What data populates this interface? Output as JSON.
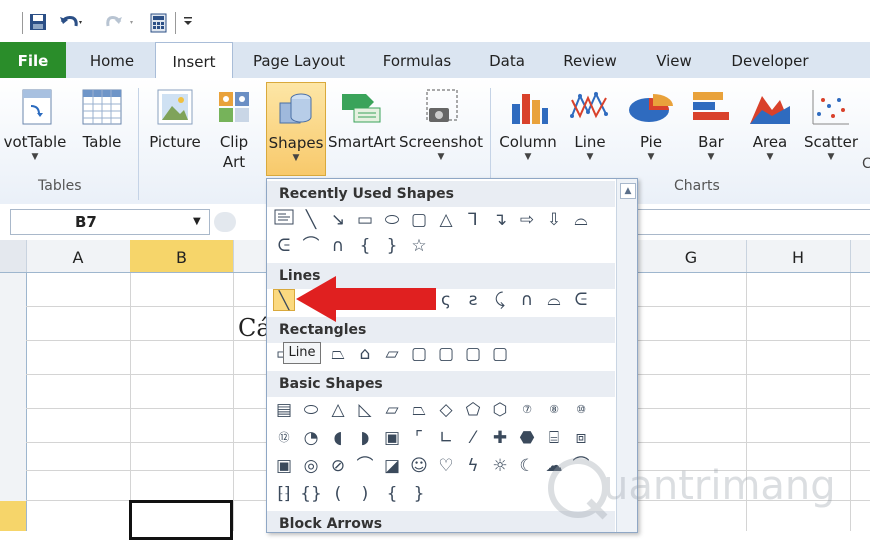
{
  "tabs": {
    "file": "File",
    "home": "Home",
    "insert": "Insert",
    "page_layout": "Page Layout",
    "formulas": "Formulas",
    "data": "Data",
    "review": "Review",
    "view": "View",
    "developer": "Developer"
  },
  "ribbon": {
    "pivottable": "votTable",
    "table": "Table",
    "picture": "Picture",
    "clip": "Clip",
    "art": "Art",
    "shapes": "Shapes",
    "smartart": "SmartArt",
    "screenshot": "Screenshot",
    "column": "Column",
    "line": "Line",
    "pie": "Pie",
    "bar": "Bar",
    "area": "Area",
    "scatter": "Scatter",
    "cut_char": "C",
    "group_tables": "Tables",
    "group_charts": "Charts"
  },
  "name_box": "B7",
  "columns": [
    "A",
    "B",
    "G",
    "H"
  ],
  "cell_text": "Cá",
  "dropdown": {
    "recent": "Recently Used Shapes",
    "lines": "Lines",
    "rectangles": "Rectangles",
    "basic": "Basic Shapes",
    "block_arrows": "Block Arrows",
    "tooltip": "Line"
  },
  "watermark": "uantrimang",
  "colors": {
    "file_tab": "#2a8d2a",
    "arrow": "#e02020",
    "selected_column": "#f6d56a",
    "ribbon_bg": "#dbe5f1"
  }
}
